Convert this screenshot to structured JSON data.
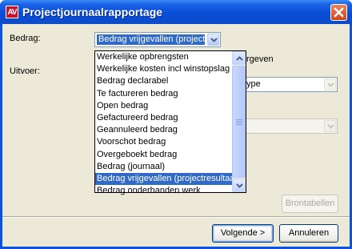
{
  "window": {
    "title": "Projectjournaalrapportage",
    "icon_text": "AV"
  },
  "form": {
    "bedrag_label": "Bedrag:",
    "bedrag_value": "Bedrag vrijgevallen (projectr",
    "uitvoer_label": "Uitvoer:",
    "checkbox_partial_label": "rgeven",
    "type_partial_value": "ype"
  },
  "dropdown": {
    "items": [
      "Werkelijke opbrengsten",
      "Werkelijke kosten incl winstopslag",
      "Bedrag declarabel",
      "Te factureren bedrag",
      "Open bedrag",
      "Gefactureerd bedrag",
      "Geannuleerd bedrag",
      "Voorschot bedrag",
      "Overgeboekt bedrag",
      "Bedrag (journaal)",
      "Bedrag vrijgevallen (projectresultaat)",
      "Bedrag onderhanden werk"
    ],
    "highlighted_index": 10
  },
  "buttons": {
    "brontabellen": "Brontabellen",
    "volgende": "Volgende >",
    "annuleren": "Annuleren"
  },
  "icons": {
    "close": "close-icon",
    "dropdown_arrow": "chevron-down-icon",
    "scroll_up": "chevron-up-icon",
    "scroll_down": "chevron-down-icon"
  },
  "colors": {
    "title_bar": "#0a50d8",
    "selection": "#316ac5",
    "dialog_bg": "#ece9d8",
    "close_button": "#d0441a"
  }
}
